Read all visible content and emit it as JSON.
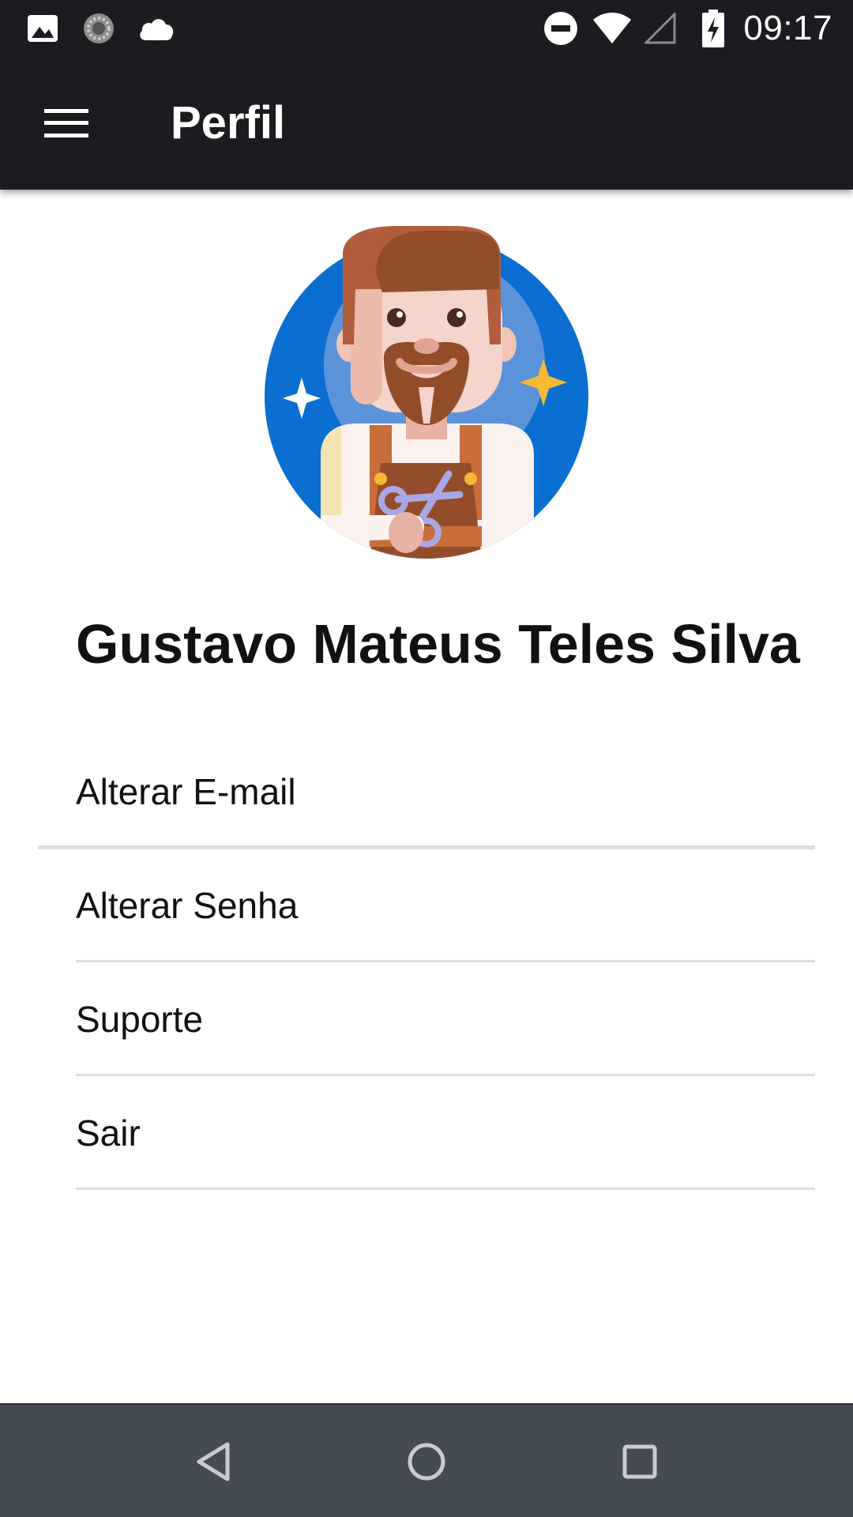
{
  "status_bar": {
    "time": "09:17",
    "icons": [
      "gallery-icon",
      "sync-icon",
      "cloud-icon",
      "do-not-disturb-icon",
      "wifi-icon",
      "cell-signal-icon",
      "battery-charging-icon"
    ]
  },
  "app_bar": {
    "title": "Perfil",
    "menu_icon": "hamburger-menu-icon"
  },
  "profile": {
    "name": "Gustavo Mateus Teles Silva",
    "avatar": "barber-avatar"
  },
  "menu": {
    "items": [
      {
        "label": "Alterar E-mail"
      },
      {
        "label": "Alterar Senha"
      },
      {
        "label": "Suporte"
      },
      {
        "label": "Sair"
      }
    ]
  },
  "navigation_bar": {
    "buttons": [
      "back-icon",
      "home-icon",
      "recents-icon"
    ]
  },
  "colors": {
    "app_bar_bg": "#1c1c20",
    "nav_bar_bg": "#454b52",
    "avatar_circle": "#0a6fd0",
    "divider": "#dddddd"
  }
}
